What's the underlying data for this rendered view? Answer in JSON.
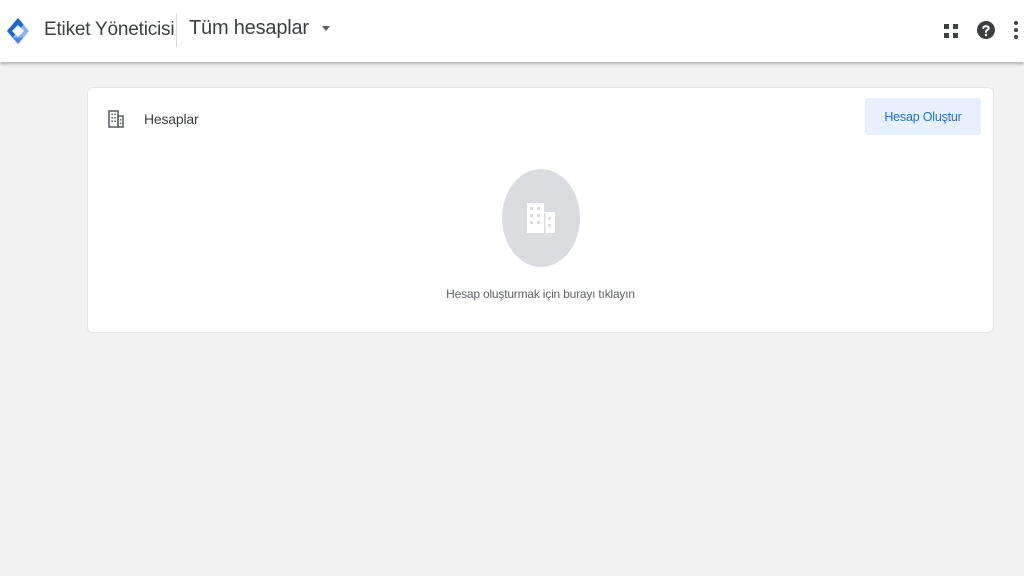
{
  "header": {
    "app_title": "Etiket Yöneticisi",
    "account_selector": "Tüm hesaplar",
    "icons": [
      "tag-manager-logo-icon",
      "chevron-down-icon",
      "apps-grid-icon",
      "help-icon",
      "more-vert-icon"
    ]
  },
  "accounts_card": {
    "title": "Hesaplar",
    "create_button": "Hesap Oluştur",
    "empty_state_text": "Hesap oluşturmak için burayı tıklayın",
    "icons": [
      "building-icon"
    ]
  },
  "colors": {
    "accent": "#1a73e8",
    "button_bg": "#e8f0fd",
    "page_bg": "#f1f2f1",
    "logo_dark": "#1967d2",
    "logo_light": "#8ab4f8"
  }
}
